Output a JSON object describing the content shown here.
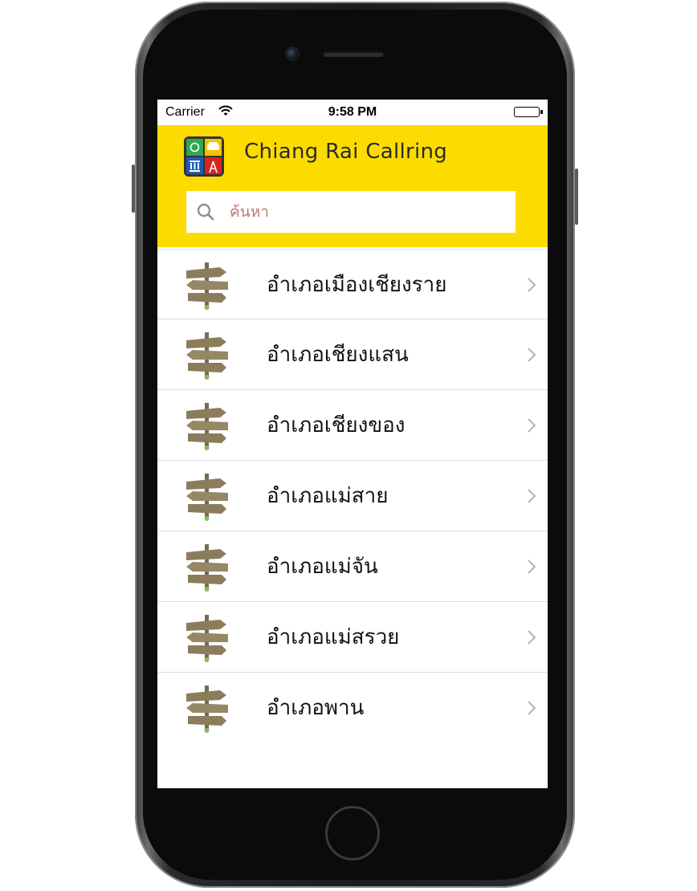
{
  "status_bar": {
    "carrier": "Carrier",
    "time": "9:58 PM"
  },
  "header": {
    "app_title": "Chiang Rai Callring",
    "background_color": "#fcdc00"
  },
  "search": {
    "placeholder": "ค้นหา",
    "value": ""
  },
  "districts": [
    {
      "label": "อำเภอเมืองเชียงราย",
      "icon": "signpost-icon"
    },
    {
      "label": "อำเภอเชียงแสน",
      "icon": "signpost-icon"
    },
    {
      "label": "อำเภอเชียงของ",
      "icon": "signpost-icon"
    },
    {
      "label": "อำเภอแม่สาย",
      "icon": "signpost-icon"
    },
    {
      "label": "อำเภอแม่จัน",
      "icon": "signpost-icon"
    },
    {
      "label": "อำเภอแม่สรวย",
      "icon": "signpost-icon"
    },
    {
      "label": "อำเภอพาน",
      "icon": "signpost-icon"
    }
  ]
}
